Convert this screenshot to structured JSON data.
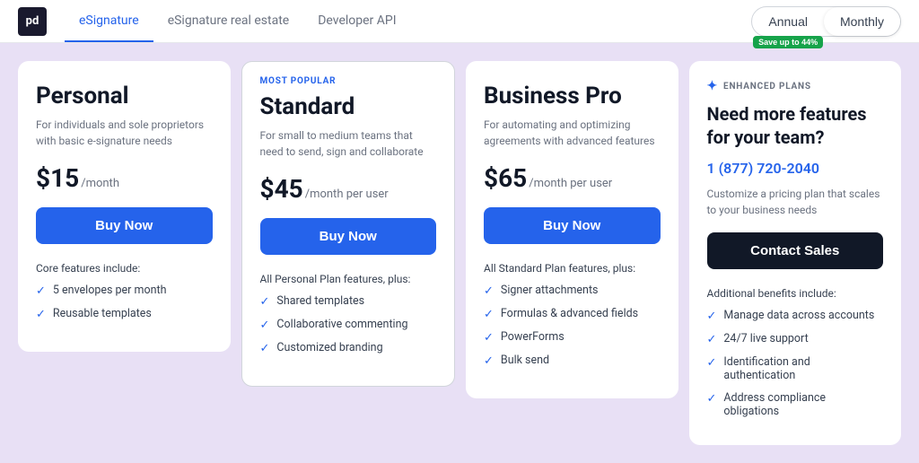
{
  "logo": {
    "text": "pd"
  },
  "tabs": [
    {
      "label": "eSignature",
      "active": true
    },
    {
      "label": "eSignature real estate",
      "active": false
    },
    {
      "label": "Developer API",
      "active": false
    }
  ],
  "billing": {
    "annual_label": "Annual",
    "monthly_label": "Monthly",
    "save_badge": "Save up to 44%",
    "active": "monthly"
  },
  "plans": [
    {
      "id": "personal",
      "name": "Personal",
      "most_popular": false,
      "description": "For individuals and sole proprietors with basic e-signature needs",
      "price": "$15",
      "period": "/month",
      "buy_label": "Buy Now",
      "features_title": "Core features include:",
      "features": [
        "5 envelopes per month",
        "Reusable templates"
      ]
    },
    {
      "id": "standard",
      "name": "Standard",
      "most_popular": true,
      "most_popular_label": "MOST POPULAR",
      "description": "For small to medium teams that need to send, sign and collaborate",
      "price": "$45",
      "period": "/month per user",
      "buy_label": "Buy Now",
      "features_title": "All Personal Plan features, plus:",
      "features": [
        "Shared templates",
        "Collaborative commenting",
        "Customized branding"
      ]
    },
    {
      "id": "business-pro",
      "name": "Business Pro",
      "most_popular": false,
      "description": "For automating and optimizing agreements with advanced features",
      "price": "$65",
      "period": "/month per user",
      "buy_label": "Buy Now",
      "features_title": "All Standard Plan features, plus:",
      "features": [
        "Signer attachments",
        "Formulas & advanced fields",
        "PowerForms",
        "Bulk send"
      ]
    }
  ],
  "enhanced": {
    "header_label": "ENHANCED PLANS",
    "title": "Need more features for your team?",
    "phone": "1 (877) 720-2040",
    "description": "Customize a pricing plan that scales to your business needs",
    "contact_label": "Contact Sales",
    "features_title": "Additional benefits include:",
    "features": [
      "Manage data across accounts",
      "24/7 live support",
      "Identification and authentication",
      "Address compliance obligations"
    ]
  }
}
